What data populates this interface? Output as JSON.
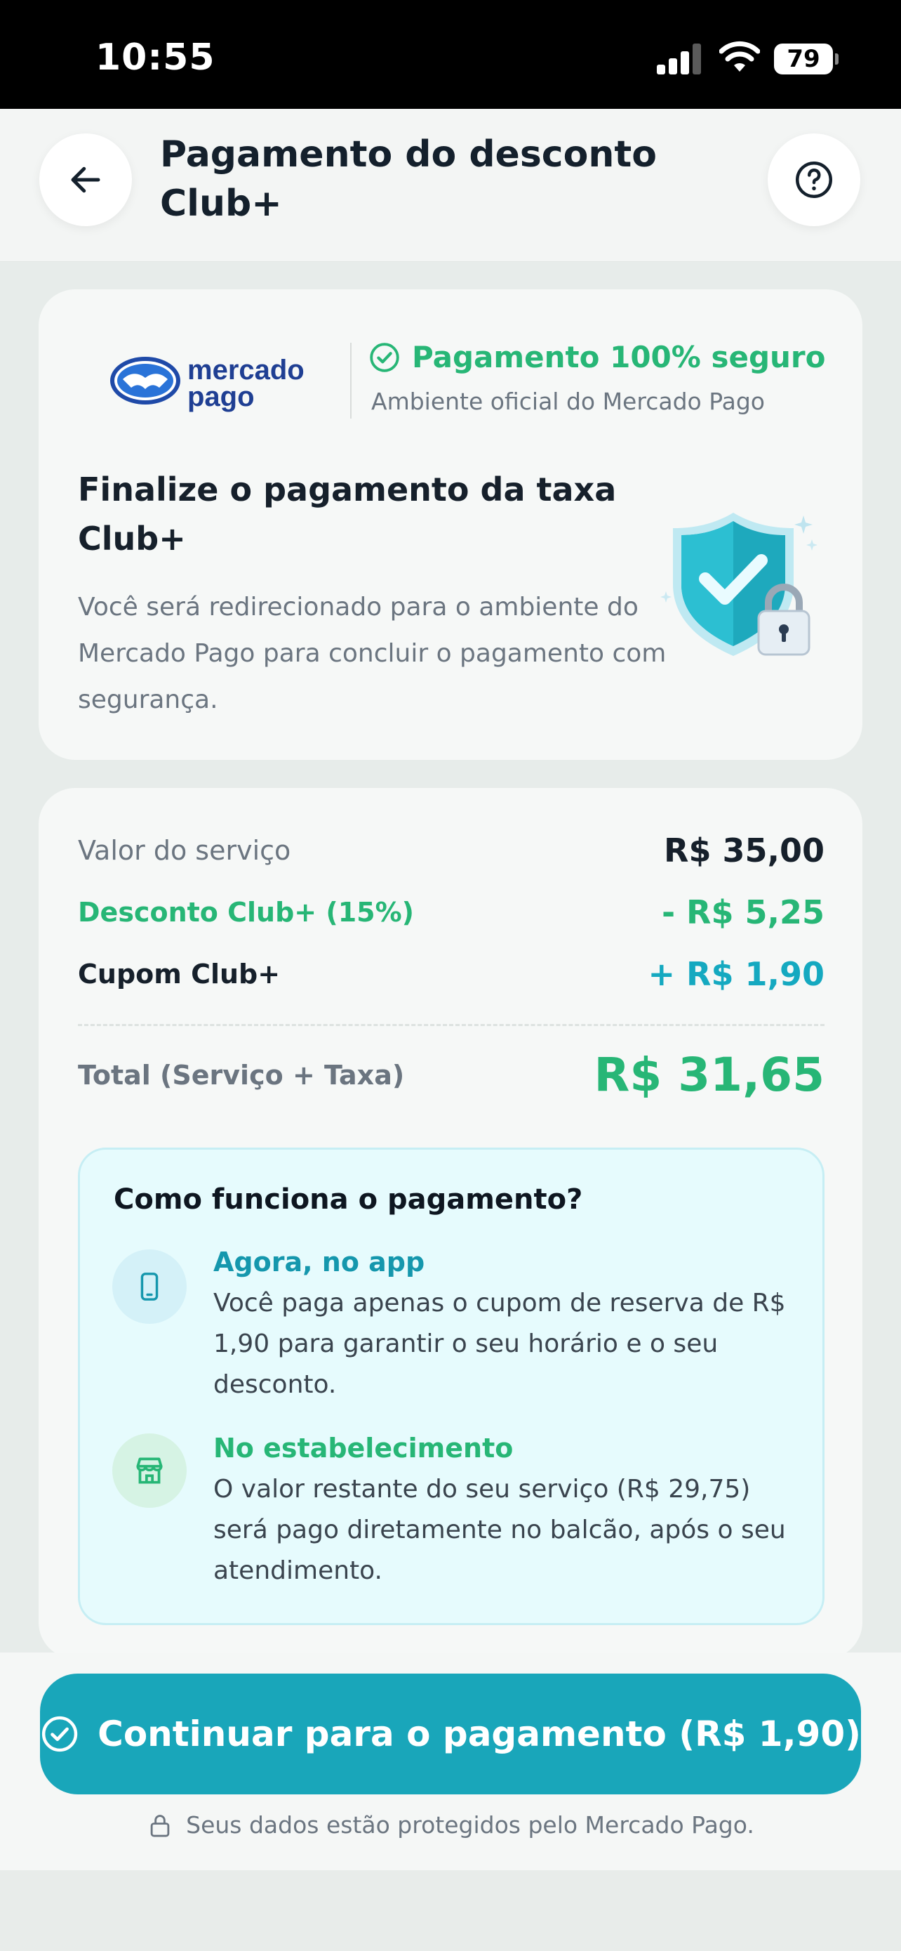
{
  "status_bar": {
    "time": "10:55",
    "battery": "79"
  },
  "header": {
    "title": "Pagamento do desconto Club+"
  },
  "payment_card": {
    "brand_line1": "mercado",
    "brand_line2": "pago",
    "secure_title": "Pagamento 100% seguro",
    "secure_subtitle": "Ambiente oficial do Mercado Pago",
    "title": "Finalize o pagamento da taxa Club+",
    "body": "Você será redirecionado para o ambiente do Mercado Pago para concluir o pagamento com segurança."
  },
  "summary": {
    "rows": [
      {
        "label": "Valor do serviço",
        "value": "R$ 35,00"
      },
      {
        "label": "Desconto Club+ (15%)",
        "value": "- R$ 5,25"
      },
      {
        "label": "Cupom Club+",
        "value": "+ R$ 1,90"
      }
    ],
    "total_label": "Total (Serviço + Taxa)",
    "total_value": "R$ 31,65"
  },
  "how_it_works": {
    "title": "Como funciona o pagamento?",
    "steps": [
      {
        "title": "Agora, no app",
        "body": "Você paga apenas o cupom de reserva de R$ 1,90 para garantir o seu horário e o seu desconto.",
        "icon": "phone-icon"
      },
      {
        "title": "No estabelecimento",
        "body": "O valor restante do seu serviço (R$ 29,75) será pago diretamente no balcão, após o seu atendimento.",
        "icon": "store-icon"
      }
    ]
  },
  "footer": {
    "cta_label": "Continuar para o pagamento (R$ 1,90)",
    "protect_text": "Seus dados estão protegidos pelo Mercado Pago."
  },
  "colors": {
    "accent": "#19a6ba",
    "success": "#27b676",
    "teal_text": "#15a9c0"
  }
}
